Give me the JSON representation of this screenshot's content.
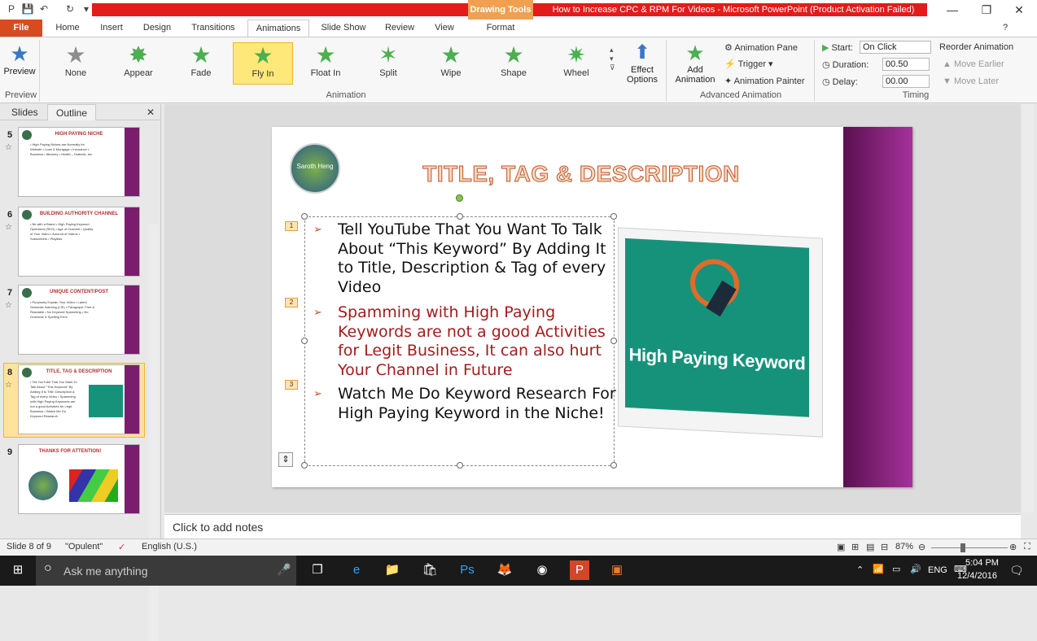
{
  "window": {
    "title": "How to Increase CPC & RPM For Videos  -  Microsoft PowerPoint (Product Activation Failed)",
    "drawing_tools": "Drawing Tools",
    "minimize": "—",
    "maximize": "❐",
    "close": "✕"
  },
  "tabs": {
    "file": "File",
    "home": "Home",
    "insert": "Insert",
    "design": "Design",
    "transitions": "Transitions",
    "animations": "Animations",
    "slideshow": "Slide Show",
    "review": "Review",
    "view": "View",
    "format": "Format"
  },
  "ribbon": {
    "preview_label": "Preview",
    "preview_group": "Preview",
    "animation_group": "Animation",
    "advanced_group": "Advanced Animation",
    "timing_group": "Timing",
    "effects": [
      {
        "label": "None"
      },
      {
        "label": "Appear"
      },
      {
        "label": "Fade"
      },
      {
        "label": "Fly In"
      },
      {
        "label": "Float In"
      },
      {
        "label": "Split"
      },
      {
        "label": "Wipe"
      },
      {
        "label": "Shape"
      },
      {
        "label": "Wheel"
      }
    ],
    "effect_options": "Effect Options",
    "add_animation": "Add Animation",
    "animation_pane": "Animation Pane",
    "trigger": "Trigger",
    "animation_painter": "Animation Painter",
    "start_label": "Start:",
    "start_value": "On Click",
    "duration_label": "Duration:",
    "duration_value": "00.50",
    "delay_label": "Delay:",
    "delay_value": "00.00",
    "reorder": "Reorder Animation",
    "move_earlier": "Move Earlier",
    "move_later": "Move Later"
  },
  "left_pane": {
    "tab_slides": "Slides",
    "tab_outline": "Outline",
    "slides": [
      {
        "num": "5",
        "title": "HIGH PAYING NICHE",
        "lines": "• High Paying Niches are Normally for Website • Loan & Mortgage • Insurance • Business • Attorney • Health – Diabetic, etc"
      },
      {
        "num": "6",
        "title": "BUILDING AUTHORITY CHANNEL",
        "lines": "• Be with a Brand • High Paying Keyword Optimized (SEO) • Age of Channel • Quality of Your Video • Amount of Videos • Subscribers • Playlists"
      },
      {
        "num": "7",
        "title": "UNIQUE  CONTENT/POST",
        "lines": "• Purposely Explain Your Video • Latent Semantic Indexing (LSI) • Paragraph: Free & Readable • No Keyword Spamming • No Grammar & Spelling Error"
      },
      {
        "num": "8",
        "title": "TITLE, TAG & DESCRIPTION",
        "lines": "• Tell YouTube That You Want To Talk About \"This Keyword\" By Adding It to Title, Description & Tag of every Video • Spamming with High Paying Keywords are not a good Activities for Legit Business • Watch Me Do Keyword Research"
      },
      {
        "num": "9",
        "title": "THANKS FOR ATTENTION!",
        "lines": ""
      }
    ]
  },
  "slide": {
    "logo_text": "Saroth Heng",
    "title": "TITLE, TAG & DESCRIPTION",
    "bullets": [
      {
        "num": "1",
        "text": "Tell YouTube That You Want To Talk About “This Keyword” By Adding It to Title, Description & Tag of every Video"
      },
      {
        "num": "2",
        "text": "Spamming with High Paying Keywords are not a good Activities for Legit Business, It can also hurt Your Channel in Future"
      },
      {
        "num": "3",
        "text": "Watch Me Do Keyword Research For High Paying Keyword in the Niche!"
      }
    ],
    "image_text": "High Paying Keyword"
  },
  "notes": {
    "placeholder": "Click to add notes"
  },
  "status": {
    "slide_info": "Slide 8 of 9",
    "theme": "\"Opulent\"",
    "language": "English (U.S.)",
    "zoom": "87%"
  },
  "taskbar": {
    "search": "Ask me anything",
    "lang": "ENG",
    "time": "5:04 PM",
    "date": "12/4/2016"
  },
  "colors": {
    "file_tab": "#d94b1e",
    "title_red": "#e31b1b",
    "selected_effect": "#ffe87a",
    "accent_purple": "#7a1d6e",
    "bullet_red": "#a31c1c"
  }
}
